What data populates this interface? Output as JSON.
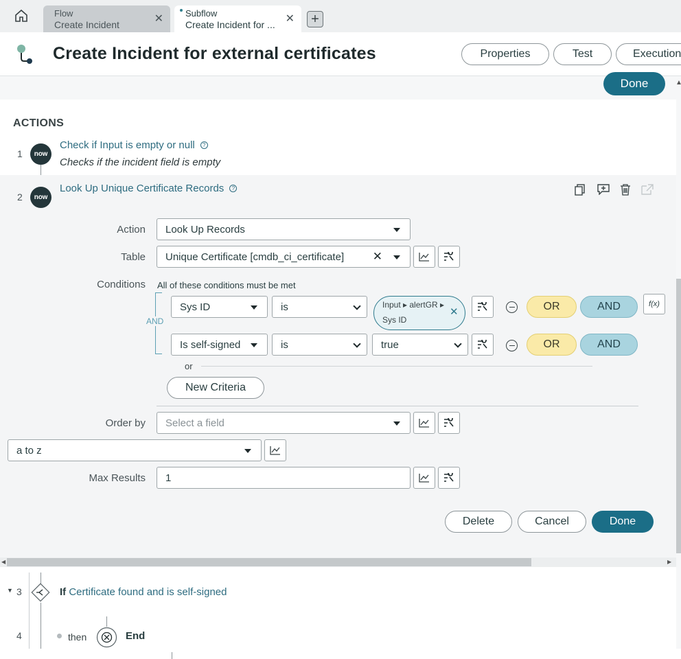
{
  "tabs": [
    {
      "type": "Flow",
      "title": "Create Incident"
    },
    {
      "type": "Subflow",
      "title": "Create Incident for ..."
    }
  ],
  "page_title": "Create Incident for external certificates",
  "header_buttons": {
    "properties": "Properties",
    "test": "Test",
    "executions": "Executions"
  },
  "top_done": "Done",
  "actions_heading": "ACTIONS",
  "steps": [
    {
      "num": "1",
      "badge": "now",
      "title": "Check if Input is empty or null",
      "subtitle": "Checks if the incident field is empty"
    },
    {
      "num": "2",
      "badge": "now",
      "title": "Look Up Unique Certificate Records"
    }
  ],
  "form": {
    "action_label": "Action",
    "action_value": "Look Up Records",
    "table_label": "Table",
    "table_value": "Unique Certificate [cmdb_ci_certificate]",
    "conditions_label": "Conditions",
    "conditions_note": "All of these conditions must be met",
    "and_connector": "AND",
    "conditions": [
      {
        "field": "Sys ID",
        "op": "is",
        "pill_line1": "Input ▸ alertGR ▸",
        "pill_line2": "Sys ID"
      },
      {
        "field": "Is self-signed",
        "op": "is",
        "value": "true"
      }
    ],
    "or_pill": "OR",
    "and_pill": "AND",
    "fx": "f(x)",
    "or_text": "or",
    "new_criteria": "New Criteria",
    "order_by_label": "Order by",
    "order_by_placeholder": "Select a field",
    "sort_value": "a to z",
    "max_results_label": "Max Results",
    "max_results_value": "1"
  },
  "footer_buttons": {
    "delete": "Delete",
    "cancel": "Cancel",
    "done": "Done"
  },
  "step3": {
    "num": "3",
    "if": "If",
    "condition": "Certificate found and is self-signed"
  },
  "step4": {
    "num": "4",
    "then": "then",
    "end": "End"
  }
}
